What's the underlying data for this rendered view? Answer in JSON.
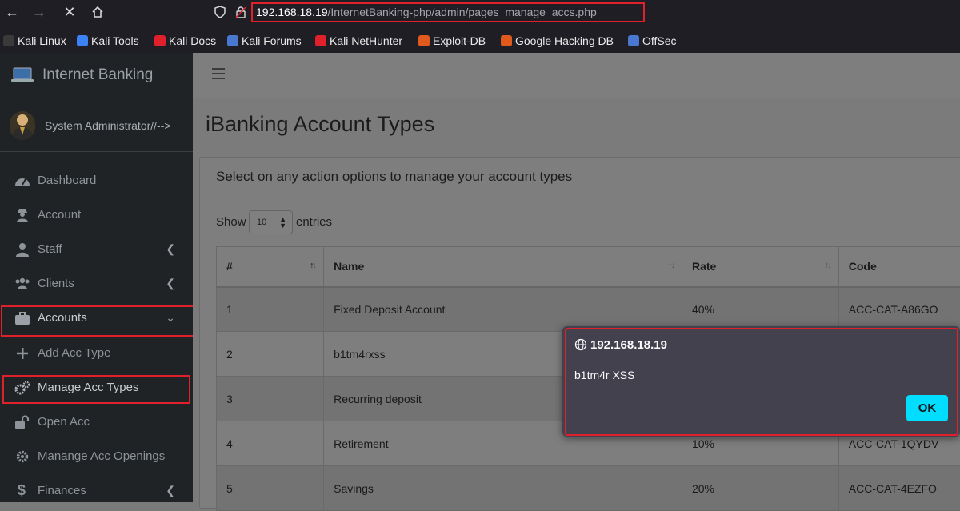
{
  "browser": {
    "url_host": "192.168.18.19",
    "url_path": "/InternetBanking-php/admin/pages_manage_accs.php"
  },
  "bookmarks": [
    {
      "label": "Kali Linux",
      "color": "#ffffff"
    },
    {
      "label": "Kali Tools",
      "color": "#3b82f6"
    },
    {
      "label": "Kali Docs",
      "color": "#e0202a"
    },
    {
      "label": "Kali Forums",
      "color": "#4a78d0"
    },
    {
      "label": "Kali NetHunter",
      "color": "#e0202a"
    },
    {
      "label": "Exploit-DB",
      "color": "#e05a1e"
    },
    {
      "label": "Google Hacking DB",
      "color": "#e05a1e"
    },
    {
      "label": "OffSec",
      "color": "#4a78d0"
    }
  ],
  "sidebar": {
    "brand": "Internet Banking",
    "user": "System Administrator//-->",
    "items": [
      {
        "label": "Dashboard",
        "icon": "tachometer-icon",
        "chevron": ""
      },
      {
        "label": "Account",
        "icon": "user-secret-icon",
        "chevron": ""
      },
      {
        "label": "Staff",
        "icon": "user-tie-icon",
        "chevron": "left"
      },
      {
        "label": "Clients",
        "icon": "users-icon",
        "chevron": "left"
      },
      {
        "label": "Accounts",
        "icon": "briefcase-icon",
        "chevron": "down"
      },
      {
        "label": "Add Acc Type",
        "icon": "plus-icon",
        "chevron": ""
      },
      {
        "label": "Manage Acc Types",
        "icon": "cogs-icon",
        "chevron": ""
      },
      {
        "label": "Open Acc",
        "icon": "lock-open-icon",
        "chevron": ""
      },
      {
        "label": "Manange Acc Openings",
        "icon": "gear-icon",
        "chevron": ""
      },
      {
        "label": "Finances",
        "icon": "dollar-icon",
        "chevron": "left"
      }
    ]
  },
  "main": {
    "title": "iBanking Account Types",
    "card_header": "Select on any action options to manage your account types",
    "show_label": "Show",
    "entries_value": "10",
    "entries_label": "entries",
    "columns": [
      "#",
      "Name",
      "Rate",
      "Code"
    ],
    "rows": [
      {
        "num": "1",
        "name": "Fixed Deposit Account",
        "rate": "40%",
        "code": "ACC-CAT-A86GO"
      },
      {
        "num": "2",
        "name": "b1tm4rxss",
        "rate": "",
        "code": ""
      },
      {
        "num": "3",
        "name": "Recurring deposit",
        "rate": "",
        "code": ""
      },
      {
        "num": "4",
        "name": "Retirement",
        "rate": "10%",
        "code": "ACC-CAT-1QYDV"
      },
      {
        "num": "5",
        "name": "Savings",
        "rate": "20%",
        "code": "ACC-CAT-4EZFO"
      }
    ]
  },
  "dialog": {
    "title": "192.168.18.19",
    "message": "b1tm4r XSS",
    "ok_label": "OK"
  },
  "colors": {
    "highlight": "#e0202a",
    "ok_button": "#00ddff",
    "sidebar_bg": "#1f2326"
  }
}
